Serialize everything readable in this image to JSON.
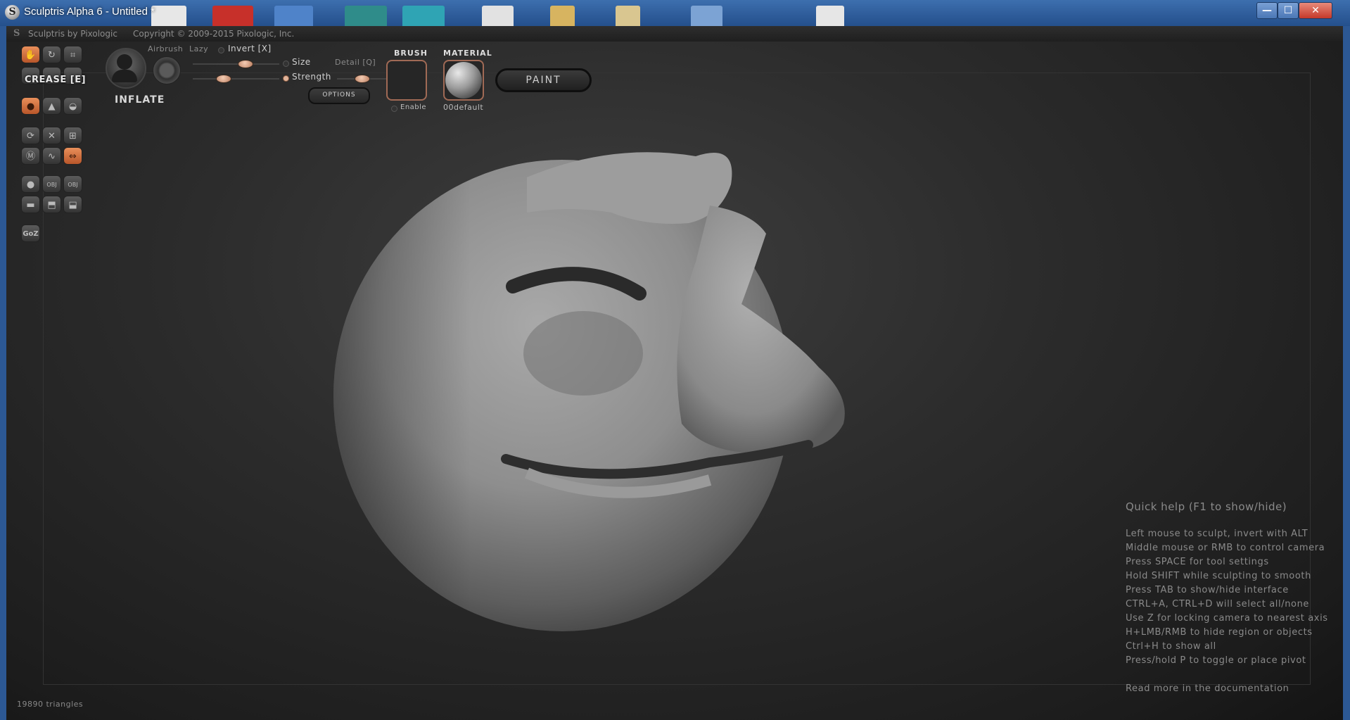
{
  "window": {
    "title": "Sculptris Alpha 6 - Untitled *",
    "minimize_glyph": "—",
    "maximize_glyph": "☐",
    "close_glyph": "✕"
  },
  "app_header": {
    "logo_glyph": "S",
    "name": "Sculptris by Pixologic",
    "copyright": "Copyright © 2009-2015 Pixologic, Inc."
  },
  "tool_panel": {
    "active_tool_tooltip": "CREASE [E]",
    "goz_label": "GoZ",
    "current_tool": "INFLATE",
    "airbrush_label": "Airbrush",
    "lazy_label": "Lazy",
    "invert_label": "Invert [X]",
    "size_label": "Size",
    "detail_label": "Detail [Q]",
    "strength_label": "Strength",
    "options_label": "OPTIONS",
    "size_value": 0.6,
    "strength_value": 0.35,
    "detail_value": 0.5
  },
  "brush_slot": {
    "title": "BRUSH",
    "enable_label": "Enable"
  },
  "material_slot": {
    "title": "MATERIAL",
    "name": "00default"
  },
  "paint_button": "PAINT",
  "quick_help": {
    "title": "Quick help (F1 to show/hide)",
    "lines": [
      "Left mouse to sculpt, invert with ALT",
      "Middle mouse or RMB to control camera",
      "Press SPACE for tool settings",
      "Hold SHIFT while sculpting to smooth",
      "Press TAB to show/hide interface",
      "CTRL+A, CTRL+D will select all/none",
      "Use Z for locking camera to nearest axis",
      "H+LMB/RMB to hide region or objects",
      "Ctrl+H to show all",
      "Press/hold P to toggle or place pivot"
    ],
    "more": "Read more in the documentation"
  },
  "status": {
    "triangles": "19890 triangles"
  },
  "accent_color": "#d9753f"
}
